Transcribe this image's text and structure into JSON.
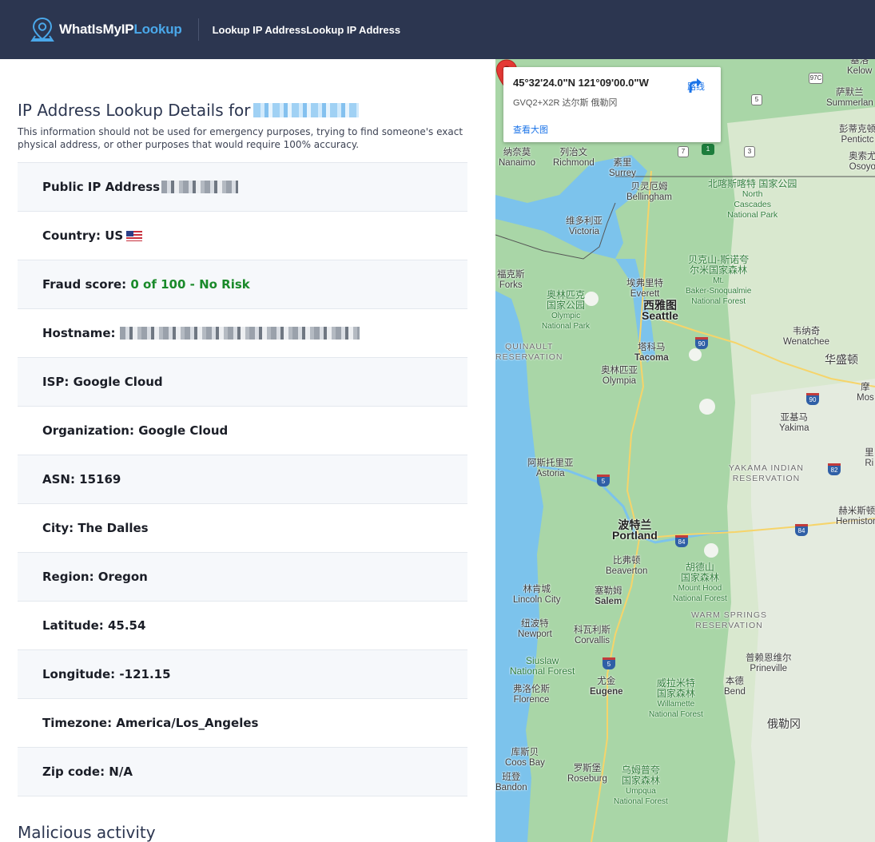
{
  "header": {
    "logo_part1": "WhatIsMyIP",
    "logo_part2": "Lookup",
    "nav_link": "Lookup IP AddressLookup IP Address"
  },
  "main": {
    "title": "IP Address Lookup Details for",
    "disclaimer": "This information should not be used for emergency purposes, trying to find someone's exact physical address, or other purposes that would require 100% accuracy.",
    "rows": {
      "public_ip_label": "Public IP Address",
      "country_label": "Country:",
      "country_value": "US",
      "fraud_label": "Fraud score:",
      "fraud_value": "0 of 100 - No Risk",
      "hostname_label": "Hostname:",
      "isp": "ISP: Google Cloud",
      "organization": "Organization: Google Cloud",
      "asn": "ASN: 15169",
      "city": "City: The Dalles",
      "region": "Region: Oregon",
      "latitude": "Latitude: 45.54",
      "longitude": "Longitude: -121.15",
      "timezone": "Timezone: America/Los_Angeles",
      "zip": "Zip code: N/A"
    },
    "next_section_title": "Malicious activity"
  },
  "map": {
    "card": {
      "coords": "45°32'24.0\"N 121°09'00.0\"W",
      "plus_code": "GVQ2+X2R 达尔斯 俄勒冈",
      "directions": "路线",
      "view_larger": "查看大图"
    },
    "labels": {
      "nanaimo_cn": "纳奈莫",
      "nanaimo": "Nanaimo",
      "richmond_cn": "列治文",
      "richmond": "Richmond",
      "surrey_cn": "素里",
      "surrey": "Surrey",
      "bellingham_cn": "贝灵厄姆",
      "bellingham": "Bellingham",
      "ncascades_cn": "北喀斯喀特\n国家公园",
      "ncascades": "North\nCascades\nNational Park",
      "victoria_cn": "维多利亚",
      "victoria": "Victoria",
      "forks_cn": "福克斯",
      "forks": "Forks",
      "everett_cn": "埃弗里特",
      "everett": "Everett",
      "mtbaker_cn": "贝克山-斯诺夸\n尔米国家森林",
      "mtbaker": "Mt.\nBaker-Snoqualmie\nNational Forest",
      "olympic_cn": "奥林匹克\n国家公园",
      "olympic": "Olympic\nNational Park",
      "seattle_cn": "西雅图",
      "seattle": "Seattle",
      "wenatchee_cn": "韦纳奇",
      "wenatchee": "Wenatchee",
      "quinault": "QUINAULT\nRESERVATION",
      "tacoma_cn": "塔科马",
      "tacoma": "Tacoma",
      "washington_cn": "华盛顿",
      "olympia_cn": "奥林匹亚",
      "olympia": "Olympia",
      "yakima_cn": "亚基马",
      "yakima": "Yakima",
      "yakama": "YAKAMA INDIAN\nRESERVATION",
      "astoria_cn": "阿斯托里亚",
      "astoria": "Astoria",
      "portland_cn": "波特兰",
      "portland": "Portland",
      "hermiston_cn": "赫米斯顿",
      "hermiston": "Hermiston",
      "beaverton_cn": "比弗顿",
      "beaverton": "Beaverton",
      "mthood_cn": "胡德山\n国家森林",
      "mthood": "Mount Hood\nNational Forest",
      "lincoln_cn": "林肯城",
      "lincoln": "Lincoln City",
      "salem_cn": "塞勒姆",
      "salem": "Salem",
      "warmsprings": "WARM SPRINGS\nRESERVATION",
      "newport_cn": "纽波特",
      "newport": "Newport",
      "corvallis_cn": "科瓦利斯",
      "corvallis": "Corvallis",
      "prineville_cn": "普赖恩维尔",
      "prineville": "Prineville",
      "siuslaw": "Siuslaw\nNational Forest",
      "eugene_cn": "尤金",
      "eugene": "Eugene",
      "florence_cn": "弗洛伦斯",
      "florence": "Florence",
      "willamette_cn": "威拉米特\n国家森林",
      "willamette": "Willamette\nNational Forest",
      "bend_cn": "本德",
      "bend": "Bend",
      "oregon_cn": "俄勒冈",
      "coosbay_cn": "库斯贝",
      "coosbay": "Coos Bay",
      "roseburg_cn": "罗斯堡",
      "roseburg": "Roseburg",
      "umpqua_cn": "乌姆普夸\n国家森林",
      "umpqua": "Umpqua\nNational Forest",
      "bandon_cn": "班登",
      "bandon": "Bandon",
      "kelowna_cn": "基洛",
      "kelowna": "Kelow",
      "summerland_cn": "萨默兰",
      "summerland": "Summerlan",
      "penticton_cn": "彭蒂克顿",
      "penticton": "Pentictc",
      "osoyoos_cn": "奥索尤",
      "osoyoos": "Osoyo",
      "moses_cn": "摩",
      "moses": "Mos",
      "richland_cn": "里",
      "richland": "Ri"
    },
    "shields": {
      "s97c": "97C",
      "s5a": "5",
      "s7": "7",
      "s3": "3",
      "s1": "1",
      "i90a": "90",
      "i90b": "90",
      "i82": "82",
      "i84a": "84",
      "i84b": "84",
      "i5a": "5",
      "i5b": "5"
    }
  }
}
